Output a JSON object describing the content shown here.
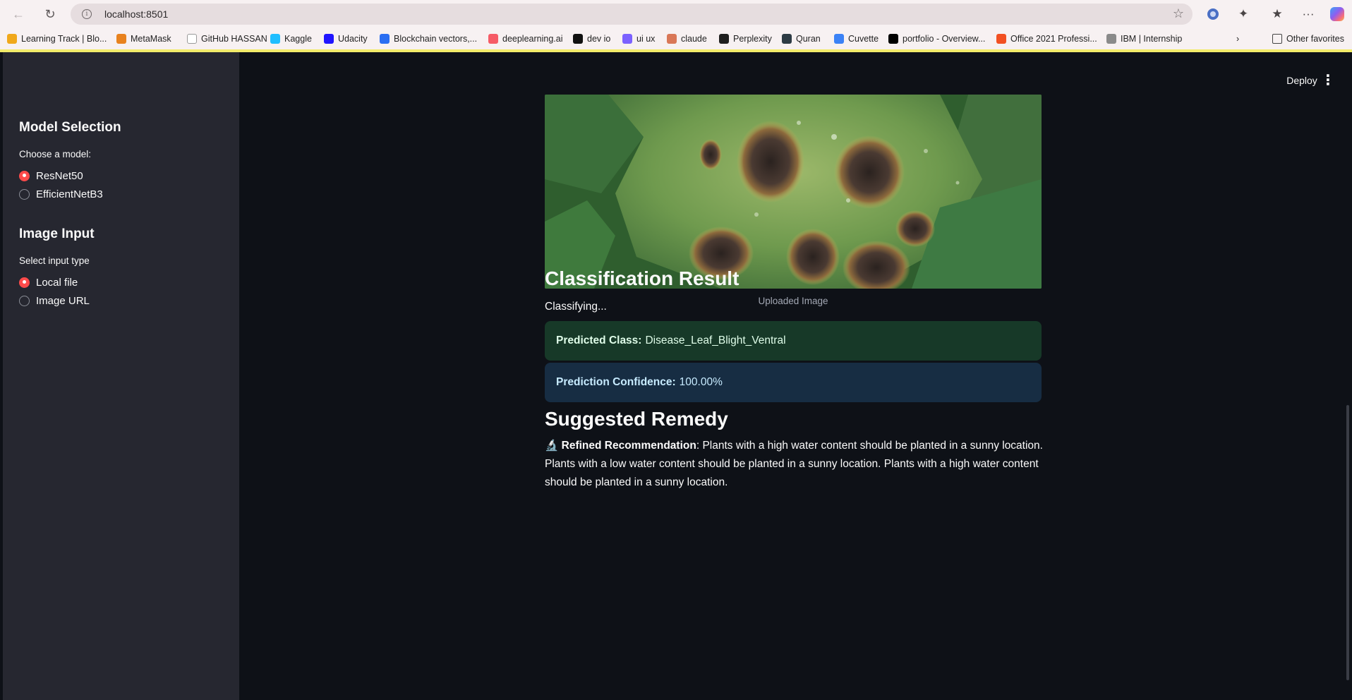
{
  "browser": {
    "url": "localhost:8501",
    "bookmarks": [
      {
        "label": "Learning Track | Blo...",
        "color": "#f0a81b"
      },
      {
        "label": "MetaMask",
        "color": "#e8821e"
      },
      {
        "label": "GitHub HASSAN",
        "color": "#ffffff"
      },
      {
        "label": "Kaggle",
        "color": "#20beff"
      },
      {
        "label": "Udacity",
        "color": "#2015ff"
      },
      {
        "label": "Blockchain vectors,...",
        "color": "#2a6ef2"
      },
      {
        "label": "deeplearning.ai",
        "color": "#f65b66"
      },
      {
        "label": "dev io",
        "color": "#111111"
      },
      {
        "label": "ui ux",
        "color": "#7b61ff"
      },
      {
        "label": "claude",
        "color": "#d97757"
      },
      {
        "label": "Perplexity",
        "color": "#1f1f1f"
      },
      {
        "label": "Quran",
        "color": "#2d3b44"
      },
      {
        "label": "Cuvette",
        "color": "#3b82f6"
      },
      {
        "label": "portfolio - Overview...",
        "color": "#000000"
      },
      {
        "label": "Office 2021 Professi...",
        "color": "#f25022"
      },
      {
        "label": "IBM | Internship",
        "color": "#8a8a8a"
      }
    ],
    "other_favorites": "Other favorites"
  },
  "sidebar": {
    "model_heading": "Model Selection",
    "model_label": "Choose a model:",
    "model_options": [
      {
        "label": "ResNet50",
        "selected": true
      },
      {
        "label": "EfficientNetB3",
        "selected": false
      }
    ],
    "input_heading": "Image Input",
    "input_label": "Select input type",
    "input_options": [
      {
        "label": "Local file",
        "selected": true
      },
      {
        "label": "Image URL",
        "selected": false
      }
    ]
  },
  "header": {
    "deploy_label": "Deploy"
  },
  "main": {
    "image_caption": "Uploaded Image",
    "classification_heading": "Classification Result",
    "status_text": "Classifying...",
    "predicted_class_label": "Predicted Class:",
    "predicted_class_value": "Disease_Leaf_Blight_Ventral",
    "confidence_label": "Prediction Confidence:",
    "confidence_value": "100.00%",
    "remedy_heading": "Suggested Remedy",
    "remedy_icon": "🔬",
    "remedy_label": "Refined Recommendation",
    "remedy_text": ": Plants with a high water content should be planted in a sunny location. Plants with a low water content should be planted in a sunny location. Plants with a high water content should be planted in a sunny location."
  },
  "colors": {
    "accent": "#ff4b4b",
    "sidebar_bg": "#262730",
    "main_bg": "#0e1117",
    "success_bg": "#173928",
    "info_bg": "#172d43"
  }
}
